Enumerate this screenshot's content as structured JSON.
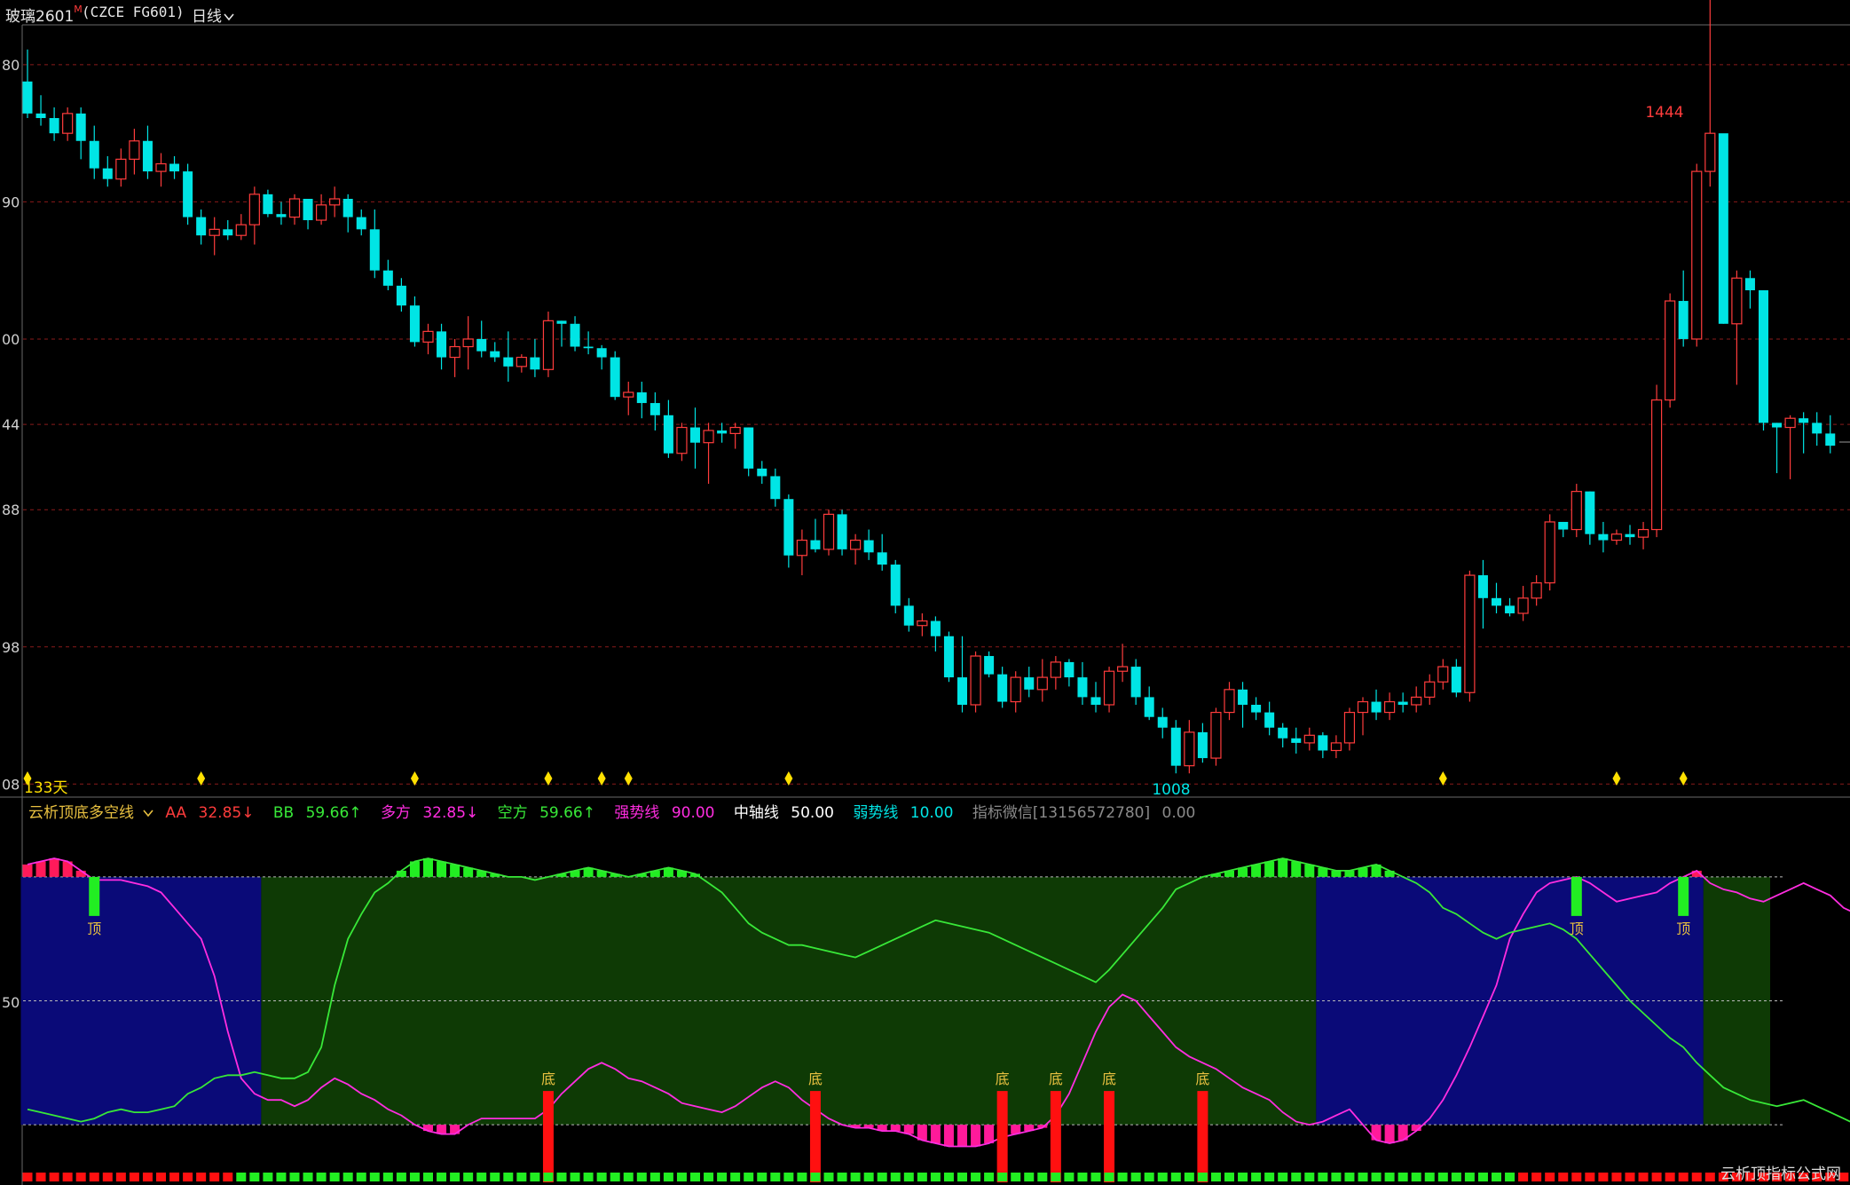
{
  "header": {
    "symbol_name": "玻璃2601",
    "symbol_mark": "M",
    "symbol_code": "(CZCE FG601)",
    "period_label": "日线",
    "period_icon": "chevron-down-icon"
  },
  "price_axis": {
    "labels": [
      "80",
      "90",
      "00",
      "44",
      "88",
      "98",
      "08"
    ],
    "values": [
      1380,
      1290,
      1200,
      1144,
      1088,
      998,
      908
    ]
  },
  "annotations": {
    "high_label": "1444",
    "low_label": "1008",
    "days_label": "133天"
  },
  "indicator": {
    "name": "云析顶底多空线",
    "aa_label": "AA",
    "aa_value": "32.85↓",
    "bb_label": "BB",
    "bb_value": "59.66↑",
    "duo_label": "多方",
    "duo_value": "32.85↓",
    "kong_label": "空方",
    "kong_value": "59.66↑",
    "strong_label": "强势线",
    "strong_value": "90.00",
    "mid_label": "中轴线",
    "mid_value": "50.00",
    "weak_label": "弱势线",
    "weak_value": "10.00",
    "wechat_label": "指标微信[13156572780]",
    "wechat_value": "0.00",
    "axis_label": "50",
    "top_mark": "顶",
    "bottom_mark": "底"
  },
  "watermark": "云析顶指标公式网",
  "colors": {
    "background": "#000000",
    "up": "#ff3c3c",
    "down": "#00e5e5",
    "grid": "#8a1a1a",
    "diamond": "#ffe000",
    "bull_zone": "#0e3a05",
    "bear_zone": "#0a0a78",
    "aa_line": "#ff2de0",
    "bb_line": "#38e838",
    "bar_green": "#22ee22",
    "bar_red": "#ff1010"
  },
  "chart_data": {
    "type": "candlestick",
    "ylim": [
      900,
      1405
    ],
    "candles": [
      [
        1369,
        1390,
        1345,
        1348
      ],
      [
        1348,
        1360,
        1340,
        1345
      ],
      [
        1345,
        1352,
        1330,
        1335
      ],
      [
        1335,
        1352,
        1330,
        1348
      ],
      [
        1348,
        1352,
        1318,
        1330
      ],
      [
        1330,
        1340,
        1305,
        1312
      ],
      [
        1312,
        1320,
        1300,
        1305
      ],
      [
        1305,
        1325,
        1300,
        1318
      ],
      [
        1318,
        1338,
        1308,
        1330
      ],
      [
        1330,
        1340,
        1305,
        1310
      ],
      [
        1310,
        1322,
        1300,
        1315
      ],
      [
        1315,
        1320,
        1305,
        1310
      ],
      [
        1310,
        1315,
        1275,
        1280
      ],
      [
        1280,
        1285,
        1262,
        1268
      ],
      [
        1268,
        1280,
        1255,
        1272
      ],
      [
        1272,
        1278,
        1265,
        1268
      ],
      [
        1268,
        1282,
        1265,
        1275
      ],
      [
        1275,
        1300,
        1262,
        1295
      ],
      [
        1295,
        1298,
        1280,
        1282
      ],
      [
        1282,
        1290,
        1275,
        1280
      ],
      [
        1280,
        1295,
        1275,
        1292
      ],
      [
        1292,
        1292,
        1272,
        1278
      ],
      [
        1278,
        1295,
        1275,
        1288
      ],
      [
        1288,
        1300,
        1280,
        1292
      ],
      [
        1292,
        1295,
        1270,
        1280
      ],
      [
        1280,
        1285,
        1268,
        1272
      ],
      [
        1272,
        1285,
        1240,
        1245
      ],
      [
        1245,
        1252,
        1232,
        1235
      ],
      [
        1235,
        1240,
        1218,
        1222
      ],
      [
        1222,
        1228,
        1195,
        1198
      ],
      [
        1198,
        1210,
        1190,
        1205
      ],
      [
        1205,
        1210,
        1180,
        1188
      ],
      [
        1188,
        1200,
        1175,
        1195
      ],
      [
        1195,
        1215,
        1180,
        1200
      ],
      [
        1200,
        1212,
        1188,
        1192
      ],
      [
        1192,
        1198,
        1185,
        1188
      ],
      [
        1188,
        1205,
        1172,
        1182
      ],
      [
        1182,
        1190,
        1178,
        1188
      ],
      [
        1188,
        1200,
        1175,
        1180
      ],
      [
        1180,
        1218,
        1175,
        1212
      ],
      [
        1212,
        1212,
        1195,
        1210
      ],
      [
        1210,
        1215,
        1192,
        1195
      ],
      [
        1195,
        1205,
        1190,
        1194
      ],
      [
        1194,
        1196,
        1180,
        1188
      ],
      [
        1188,
        1192,
        1160,
        1162
      ],
      [
        1162,
        1172,
        1150,
        1165
      ],
      [
        1165,
        1172,
        1148,
        1158
      ],
      [
        1158,
        1165,
        1140,
        1150
      ],
      [
        1150,
        1160,
        1122,
        1125
      ],
      [
        1125,
        1145,
        1120,
        1142
      ],
      [
        1142,
        1155,
        1115,
        1132
      ],
      [
        1132,
        1145,
        1105,
        1140
      ],
      [
        1140,
        1145,
        1132,
        1138
      ],
      [
        1138,
        1145,
        1128,
        1142
      ],
      [
        1142,
        1142,
        1110,
        1115
      ],
      [
        1115,
        1120,
        1105,
        1110
      ],
      [
        1110,
        1115,
        1090,
        1095
      ],
      [
        1095,
        1098,
        1050,
        1058
      ],
      [
        1058,
        1075,
        1045,
        1068
      ],
      [
        1068,
        1082,
        1060,
        1062
      ],
      [
        1062,
        1088,
        1058,
        1085
      ],
      [
        1085,
        1088,
        1058,
        1062
      ],
      [
        1062,
        1072,
        1052,
        1068
      ],
      [
        1068,
        1075,
        1055,
        1060
      ],
      [
        1060,
        1072,
        1048,
        1052
      ],
      [
        1052,
        1055,
        1020,
        1025
      ],
      [
        1025,
        1030,
        1008,
        1012
      ],
      [
        1012,
        1020,
        1005,
        1015
      ],
      [
        1015,
        1018,
        995,
        1005
      ],
      [
        1005,
        1008,
        975,
        978
      ],
      [
        978,
        1005,
        955,
        960
      ],
      [
        960,
        995,
        955,
        992
      ],
      [
        992,
        995,
        978,
        980
      ],
      [
        980,
        985,
        958,
        962
      ],
      [
        962,
        982,
        955,
        978
      ],
      [
        978,
        985,
        965,
        970
      ],
      [
        970,
        990,
        962,
        978
      ],
      [
        978,
        992,
        970,
        988
      ],
      [
        988,
        990,
        972,
        978
      ],
      [
        978,
        988,
        960,
        965
      ],
      [
        965,
        975,
        955,
        960
      ],
      [
        960,
        985,
        955,
        982
      ],
      [
        982,
        1000,
        975,
        985
      ],
      [
        985,
        990,
        960,
        965
      ],
      [
        965,
        972,
        950,
        952
      ],
      [
        952,
        958,
        938,
        945
      ],
      [
        945,
        950,
        915,
        920
      ],
      [
        920,
        950,
        915,
        942
      ],
      [
        942,
        948,
        922,
        925
      ],
      [
        925,
        958,
        920,
        955
      ],
      [
        955,
        975,
        950,
        970
      ],
      [
        970,
        975,
        945,
        960
      ],
      [
        960,
        965,
        950,
        955
      ],
      [
        955,
        962,
        940,
        945
      ],
      [
        945,
        948,
        932,
        938
      ],
      [
        938,
        945,
        928,
        935
      ],
      [
        935,
        945,
        930,
        940
      ],
      [
        940,
        942,
        925,
        930
      ],
      [
        930,
        940,
        925,
        935
      ],
      [
        935,
        958,
        930,
        955
      ],
      [
        955,
        965,
        940,
        962
      ],
      [
        962,
        970,
        950,
        955
      ],
      [
        955,
        968,
        950,
        962
      ],
      [
        962,
        968,
        955,
        960
      ],
      [
        960,
        972,
        955,
        965
      ],
      [
        965,
        980,
        960,
        975
      ],
      [
        975,
        990,
        970,
        985
      ],
      [
        985,
        990,
        965,
        968
      ],
      [
        968,
        1048,
        962,
        1045
      ],
      [
        1045,
        1055,
        1010,
        1030
      ],
      [
        1030,
        1040,
        1020,
        1025
      ],
      [
        1025,
        1030,
        1018,
        1020
      ],
      [
        1020,
        1038,
        1015,
        1030
      ],
      [
        1030,
        1045,
        1025,
        1040
      ],
      [
        1040,
        1085,
        1035,
        1080
      ],
      [
        1080,
        1080,
        1070,
        1075
      ],
      [
        1075,
        1105,
        1070,
        1100
      ],
      [
        1100,
        1100,
        1065,
        1072
      ],
      [
        1072,
        1080,
        1060,
        1068
      ],
      [
        1068,
        1075,
        1065,
        1072
      ],
      [
        1072,
        1078,
        1065,
        1070
      ],
      [
        1070,
        1080,
        1062,
        1075
      ],
      [
        1075,
        1170,
        1070,
        1160
      ],
      [
        1160,
        1230,
        1155,
        1225
      ],
      [
        1225,
        1245,
        1195,
        1200
      ],
      [
        1200,
        1315,
        1195,
        1310
      ],
      [
        1310,
        1444,
        1300,
        1335
      ],
      [
        1335,
        1330,
        1210,
        1210
      ],
      [
        1210,
        1245,
        1170,
        1240
      ],
      [
        1240,
        1245,
        1220,
        1232
      ],
      [
        1232,
        1232,
        1140,
        1145
      ],
      [
        1145,
        1145,
        1112,
        1142
      ],
      [
        1142,
        1150,
        1108,
        1148
      ],
      [
        1148,
        1152,
        1125,
        1145
      ],
      [
        1145,
        1152,
        1130,
        1138
      ],
      [
        1138,
        1150,
        1125,
        1130
      ]
    ],
    "signal_indices": [
      0,
      13,
      29,
      39,
      43,
      45,
      57,
      106,
      119,
      124
    ],
    "indicator": {
      "ylim": [
        0,
        100
      ],
      "strong": 90,
      "mid": 50,
      "weak": 10,
      "aa": [
        94,
        95,
        96,
        95,
        92,
        89,
        89,
        89,
        88,
        87,
        85,
        80,
        75,
        70,
        58,
        40,
        25,
        20,
        18,
        18,
        16,
        18,
        22,
        25,
        23,
        20,
        18,
        15,
        13,
        10,
        8,
        7,
        7,
        10,
        12,
        12,
        12,
        12,
        12,
        15,
        20,
        24,
        28,
        30,
        28,
        25,
        24,
        22,
        20,
        17,
        16,
        15,
        14,
        16,
        19,
        22,
        24,
        22,
        18,
        15,
        12,
        10,
        9,
        9,
        8,
        8,
        7,
        5,
        4,
        3,
        3,
        3,
        4,
        6,
        7,
        8,
        9,
        13,
        20,
        30,
        40,
        48,
        52,
        50,
        45,
        40,
        35,
        32,
        30,
        28,
        25,
        22,
        20,
        18,
        14,
        11,
        10,
        11,
        13,
        15,
        10,
        5,
        4,
        5,
        8,
        12,
        18,
        26,
        35,
        45,
        55,
        70,
        78,
        85,
        88,
        89,
        90,
        88,
        85,
        82,
        83,
        84,
        85,
        88,
        90,
        92,
        88,
        86,
        85,
        83,
        82,
        84,
        86,
        88,
        86,
        84,
        80,
        78,
        72,
        65,
        55,
        45,
        38,
        33,
        28,
        22
      ],
      "bb": [
        15,
        14,
        13,
        12,
        11,
        12,
        14,
        15,
        14,
        14,
        15,
        16,
        20,
        22,
        25,
        26,
        26,
        27,
        26,
        25,
        25,
        27,
        35,
        55,
        70,
        78,
        85,
        88,
        92,
        95,
        96,
        95,
        94,
        93,
        92,
        91,
        90,
        90,
        89,
        90,
        91,
        92,
        93,
        92,
        91,
        90,
        91,
        92,
        93,
        92,
        91,
        88,
        85,
        80,
        75,
        72,
        70,
        68,
        68,
        67,
        66,
        65,
        64,
        66,
        68,
        70,
        72,
        74,
        76,
        75,
        74,
        73,
        72,
        70,
        68,
        66,
        64,
        62,
        60,
        58,
        56,
        60,
        65,
        70,
        75,
        80,
        86,
        88,
        90,
        91,
        92,
        93,
        94,
        95,
        96,
        95,
        94,
        93,
        92,
        92,
        93,
        94,
        92,
        90,
        88,
        85,
        80,
        78,
        75,
        72,
        70,
        72,
        73,
        74,
        75,
        73,
        70,
        65,
        60,
        55,
        50,
        46,
        42,
        38,
        35,
        30,
        26,
        22,
        20,
        18,
        17,
        16,
        17,
        18,
        16,
        14,
        12,
        10,
        9,
        8,
        6,
        5,
        4,
        6,
        8,
        12,
        18,
        25,
        35,
        45,
        55,
        60,
        65
      ],
      "zones": [
        {
          "start": 0,
          "end": 17,
          "kind": "bear"
        },
        {
          "start": 18,
          "end": 96,
          "kind": "bull"
        },
        {
          "start": 97,
          "end": 125,
          "kind": "bear"
        },
        {
          "start": 126,
          "end": 130,
          "kind": "bull"
        }
      ],
      "top_marks": [
        5,
        116,
        124
      ],
      "bottom_marks": [
        39,
        59,
        73,
        77,
        81,
        88
      ]
    }
  }
}
